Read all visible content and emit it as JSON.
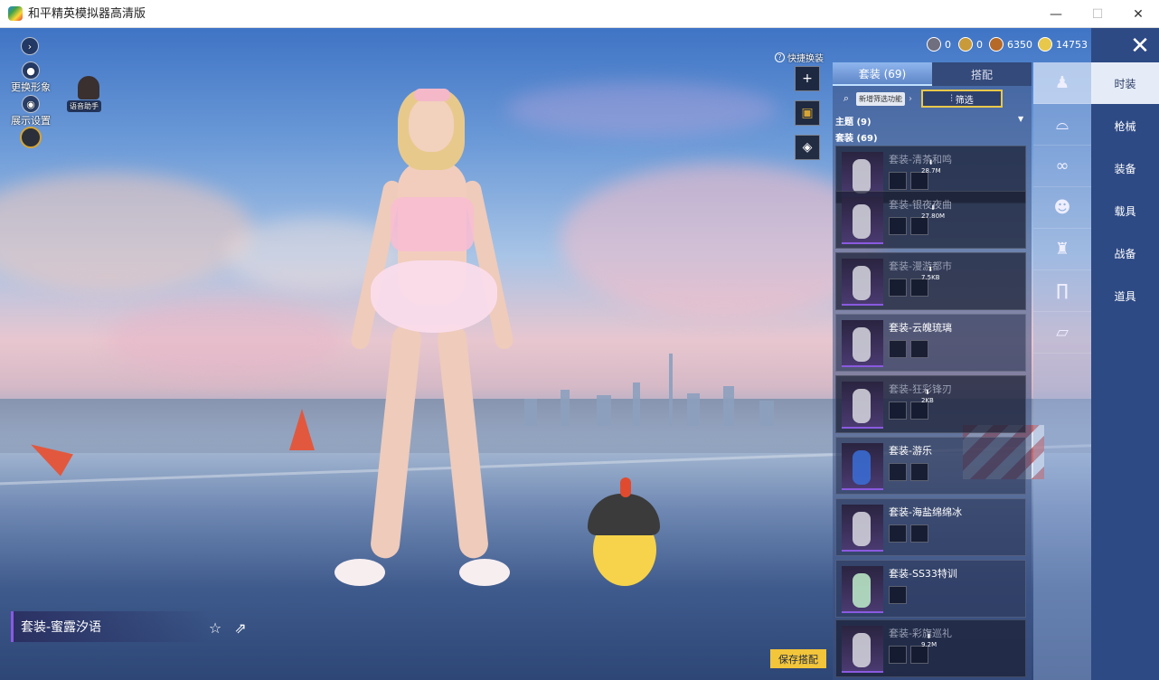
{
  "window": {
    "title": "和平精英模拟器高清版",
    "min_glyph": "—",
    "max_glyph": "☐",
    "close_glyph": "✕"
  },
  "hud": {
    "expand_glyph": "›",
    "change_avatar_label": "更换形象",
    "display_settings_label": "展示设置",
    "assistant_label": "语音助手"
  },
  "currency": [
    {
      "icon": "silver-coin-icon",
      "value": "0"
    },
    {
      "icon": "gold-medal-icon",
      "value": "0"
    },
    {
      "icon": "bronze-coin-icon",
      "value": "6350"
    },
    {
      "icon": "gold-coin-icon",
      "value": "14753"
    }
  ],
  "quick_change": {
    "label": "快捷换装",
    "help_glyph": "?"
  },
  "panel": {
    "tab_suits": "套装 (69)",
    "tab_match": "搭配",
    "filter_new": "新增筛选功能",
    "filter_button": "筛选",
    "section_theme": "主题 (9)",
    "section_suits": "套装 (69)",
    "items": [
      {
        "name": "套装-清茶和鸣",
        "size": "28.7M",
        "dim": true
      },
      {
        "name": "套装-银夜夜曲",
        "size": "27.80M",
        "dim": true
      },
      {
        "name": "套装-漫游都市",
        "size": "7.5KB",
        "dim": true
      },
      {
        "name": "套装-云魄琉璃",
        "size": "",
        "dim": false
      },
      {
        "name": "套装-狂彩锋刃",
        "size": "2KB",
        "dim": true
      },
      {
        "name": "套装-游乐",
        "size": "",
        "dim": false
      },
      {
        "name": "套装-海盐绵绵冰",
        "size": "",
        "dim": false
      },
      {
        "name": "套装-SS33特训",
        "size": "",
        "dim": false
      },
      {
        "name": "套装-彩旗巡礼",
        "size": "9.2M",
        "dim": true
      }
    ]
  },
  "categories": [
    {
      "icon": "outfit-icon"
    },
    {
      "icon": "hat-icon"
    },
    {
      "icon": "glasses-icon"
    },
    {
      "icon": "mask-icon"
    },
    {
      "icon": "top-icon"
    },
    {
      "icon": "pants-icon"
    },
    {
      "icon": "shoes-icon"
    }
  ],
  "nav": {
    "close_glyph": "✕",
    "items": [
      "时装",
      "枪械",
      "装备",
      "载具",
      "战备",
      "道具"
    ]
  },
  "bottom": {
    "outfit_name": "套装-蜜露汐语",
    "save_label": "保存搭配"
  }
}
